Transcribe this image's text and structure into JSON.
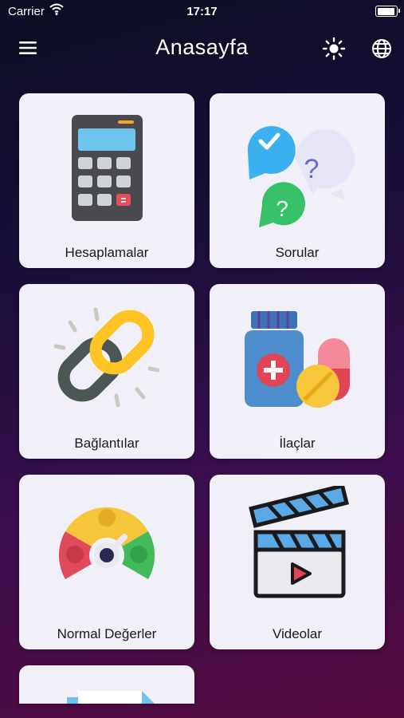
{
  "status_bar": {
    "carrier": "Carrier",
    "time": "17:17"
  },
  "header": {
    "title": "Anasayfa"
  },
  "icons": {
    "menu": "hamburger-menu-icon",
    "theme": "sun-icon",
    "language": "globe-icon"
  },
  "cards": [
    {
      "label": "Hesaplamalar",
      "icon": "calculator-icon"
    },
    {
      "label": "Sorular",
      "icon": "question-bubbles-icon"
    },
    {
      "label": "Bağlantılar",
      "icon": "chain-link-icon"
    },
    {
      "label": "İlaçlar",
      "icon": "medicine-icon"
    },
    {
      "label": "Normal Değerler",
      "icon": "gauge-icon"
    },
    {
      "label": "Videolar",
      "icon": "clapperboard-icon"
    }
  ],
  "colors": {
    "card_bg": "#f1eff7",
    "bg_top": "#0b0d22",
    "bg_bottom": "#560a3d"
  }
}
